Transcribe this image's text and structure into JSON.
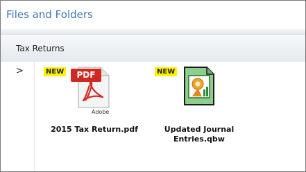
{
  "window": {
    "title": "Files and Folders"
  },
  "folder": {
    "name": "Tax Returns",
    "expander": ">"
  },
  "files": [
    {
      "name": "2015 Tax Return.pdf",
      "badge": "NEW",
      "icon": "pdf-file-icon",
      "icon_label": "PDF",
      "brand": "Adobe"
    },
    {
      "name": "Updated Journal Entries.qbw",
      "badge": "NEW",
      "icon": "quickbooks-file-icon"
    }
  ],
  "colors": {
    "title": "#3a78b5",
    "badge": "#fff200",
    "pdf_red": "#d42a22",
    "qbw_green": "#8dcf8d"
  }
}
